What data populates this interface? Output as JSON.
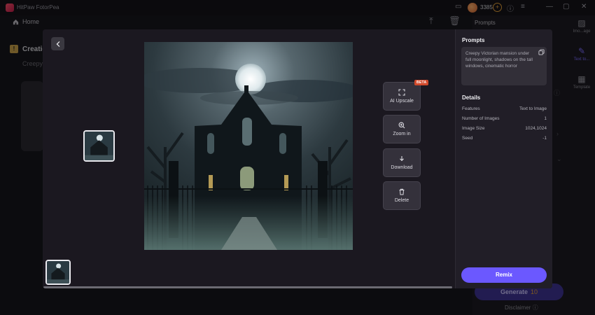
{
  "app": {
    "name": "HitPaw FotorPea",
    "coins": "3385"
  },
  "nav": {
    "home_label": "Home"
  },
  "background": {
    "section_title": "Creatio",
    "section_sub": "Creepy",
    "right_panel_title": "Prompts",
    "tabs": [
      {
        "label": "Imo...age"
      },
      {
        "label": "Text to..."
      },
      {
        "label": "Template"
      }
    ],
    "generate_label": "Generate",
    "generate_cost": "10",
    "disclaimer": "Disclaimer"
  },
  "modal": {
    "actions": {
      "upscale_label": "AI Upscale",
      "upscale_badge": "BETA",
      "zoom_label": "Zoom in",
      "download_label": "Download",
      "delete_label": "Delete"
    },
    "details": {
      "prompts_heading": "Prompts",
      "prompt_text": "Creepy Victorian mansion under full moonlight, shadows on the tall windows, cinematic horror",
      "details_heading": "Details",
      "rows": [
        {
          "label": "Features",
          "value": "Text to Image"
        },
        {
          "label": "Number of Images",
          "value": "1"
        },
        {
          "label": "Image Size",
          "value": "1024,1024"
        },
        {
          "label": "Seed",
          "value": "-1"
        }
      ],
      "remix_label": "Remix"
    }
  },
  "colors": {
    "accent": "#6b58ff",
    "beta_badge": "#d14a2c",
    "coin": "#e8a23a"
  }
}
